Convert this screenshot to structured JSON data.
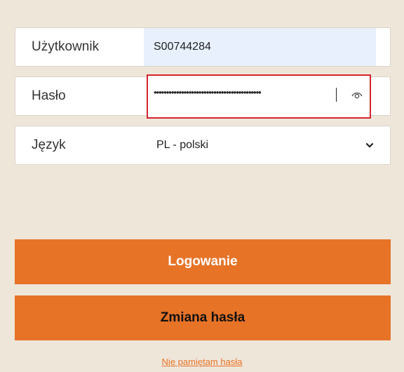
{
  "form": {
    "username": {
      "label": "Użytkownik",
      "value": "S00744284"
    },
    "password": {
      "label": "Hasło",
      "masked_value": "•••••••••••••••••••••••••••••••••••••••••••",
      "show_icon": "eye-icon"
    },
    "language": {
      "label": "Język",
      "value": "PL - polski",
      "dropdown_icon": "chevron-down-icon"
    }
  },
  "buttons": {
    "login": "Logowanie",
    "change_password": "Zmiana hasła"
  },
  "links": {
    "forgot_password": "Nie pamiętam hasła"
  },
  "colors": {
    "accent": "#e77327",
    "background": "#efe6da",
    "highlight_border": "#d4242c",
    "autofill_bg": "#e8f0fe"
  }
}
